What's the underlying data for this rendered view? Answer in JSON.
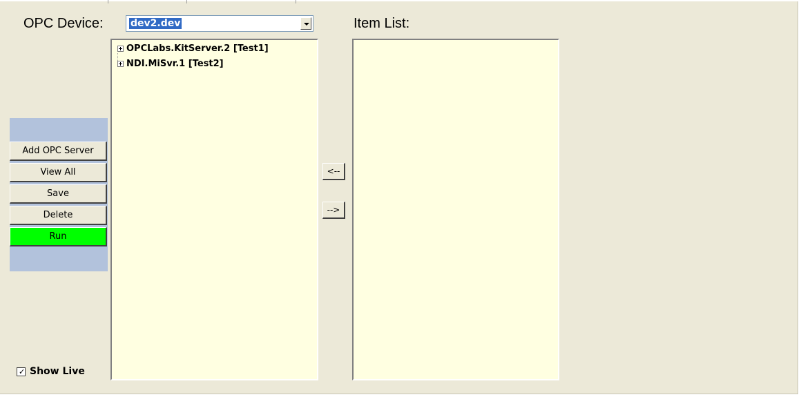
{
  "window": {
    "device_label": "OPC Device:",
    "item_list_label": "Item List:"
  },
  "device_select": {
    "value": "dev2.dev"
  },
  "tree": {
    "nodes": [
      {
        "label": "OPCLabs.KitServer.2 [Test1]"
      },
      {
        "label": "NDI.MiSvr.1 [Test2]"
      }
    ]
  },
  "sidebar": {
    "buttons": [
      {
        "label": "Add OPC Server"
      },
      {
        "label": "View All"
      },
      {
        "label": "Save"
      },
      {
        "label": "Delete"
      },
      {
        "label": "Run"
      }
    ]
  },
  "transfer": {
    "left_label": "<--",
    "right_label": "-->"
  },
  "show_live": {
    "label": "Show Live",
    "checked": true,
    "check_glyph": "✓"
  },
  "colors": {
    "background": "#ece9d8",
    "list_background": "#ffffe1",
    "sidebar_background": "#b2c2dc",
    "run_button": "#00ff00",
    "selection": "#316ac5"
  }
}
